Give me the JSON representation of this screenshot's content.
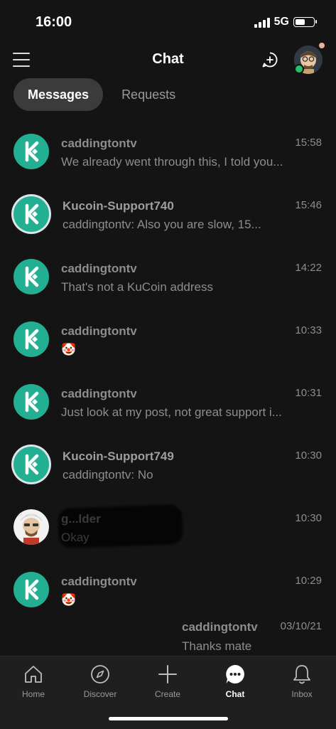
{
  "status_bar": {
    "time": "16:00",
    "network": "5G",
    "battery_level": 0.55
  },
  "header": {
    "title": "Chat"
  },
  "tabs": [
    {
      "label": "Messages",
      "active": true
    },
    {
      "label": "Requests",
      "active": false
    }
  ],
  "conversations": [
    {
      "name": "caddingtontv",
      "preview": "We already went through this, I told you...",
      "time": "15:58",
      "avatar": "kucoin-logo"
    },
    {
      "name": "Kucoin-Support740",
      "preview": "caddingtontv: Also you are slow, 15...",
      "time": "15:46",
      "avatar": "kucoin-logo"
    },
    {
      "name": "caddingtontv",
      "preview": "That's not a KuCoin address",
      "time": "14:22",
      "avatar": "kucoin-logo"
    },
    {
      "name": "caddingtontv",
      "preview": "🤡",
      "time": "10:33",
      "avatar": "kucoin-logo"
    },
    {
      "name": "caddingtontv",
      "preview": "Just look at my post, not great support i...",
      "time": "10:31",
      "avatar": "kucoin-logo"
    },
    {
      "name": "Kucoin-Support749",
      "preview": "caddingtontv: No",
      "time": "10:30",
      "avatar": "kucoin-logo"
    },
    {
      "name": "g...lder",
      "preview": "Okay",
      "time": "10:30",
      "avatar": "user-avatar"
    },
    {
      "name": "caddingtontv",
      "preview": "🤡",
      "time": "10:29",
      "avatar": "kucoin-logo"
    },
    {
      "name": "caddingtontv",
      "preview": "Thanks mate",
      "time": "03/10/21",
      "avatar": "none"
    }
  ],
  "bottom_nav": [
    {
      "label": "Home",
      "icon": "home-icon"
    },
    {
      "label": "Discover",
      "icon": "compass-icon"
    },
    {
      "label": "Create",
      "icon": "plus-icon"
    },
    {
      "label": "Chat",
      "icon": "chat-bubble-icon",
      "active": true
    },
    {
      "label": "Inbox",
      "icon": "bell-icon"
    }
  ],
  "colors": {
    "background": "#141414",
    "kucoin_green": "#23af91",
    "online": "#24c06b",
    "muted_text": "#8d8d8d",
    "tab_active_bg": "#3b3b3b",
    "nav_bg": "#1f1f1f"
  }
}
